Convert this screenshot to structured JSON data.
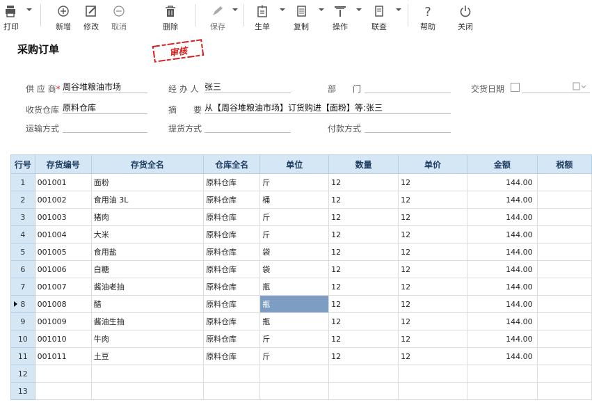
{
  "toolbar": {
    "buttons": [
      {
        "key": "print",
        "label": "打印",
        "icon": "printer-icon"
      },
      {
        "key": "new",
        "label": "新增",
        "icon": "plus-circle-icon"
      },
      {
        "key": "edit",
        "label": "修改",
        "icon": "edit-icon"
      },
      {
        "key": "cancel",
        "label": "取消",
        "icon": "minus-circle-icon"
      },
      {
        "key": "delete",
        "label": "删除",
        "icon": "trash-icon"
      },
      {
        "key": "save",
        "label": "保存",
        "icon": "pen-icon"
      },
      {
        "key": "generate",
        "label": "生单",
        "icon": "document-icon"
      },
      {
        "key": "copy",
        "label": "复制",
        "icon": "copy-icon"
      },
      {
        "key": "operate",
        "label": "操作",
        "icon": "operate-icon"
      },
      {
        "key": "query",
        "label": "联查",
        "icon": "link-query-icon"
      },
      {
        "key": "help",
        "label": "帮助",
        "icon": "help-icon"
      },
      {
        "key": "close",
        "label": "关闭",
        "icon": "power-icon"
      }
    ]
  },
  "page": {
    "title": "采购订单",
    "stamp": "审核"
  },
  "form": {
    "supplier_label": "供 应 商",
    "supplier_req": "*",
    "supplier_value": "周谷堆粮油市场",
    "handler_label": "经 办 人",
    "handler_value": "张三",
    "dept_label": "部　　门",
    "dept_value": "",
    "delivery_date_label": "交货日期",
    "warehouse_label": "收货仓库",
    "warehouse_value": "原料仓库",
    "summary_label": "摘　　要",
    "summary_value": "从【周谷堆粮油市场】订货购进【面粉】等:张三",
    "transport_label": "运输方式",
    "transport_value": "",
    "pickup_label": "提货方式",
    "pickup_value": "",
    "payment_label": "付款方式",
    "payment_value": ""
  },
  "table": {
    "columns": [
      "行号",
      "存货编号",
      "存货全名",
      "仓库全名",
      "单位",
      "数量",
      "单价",
      "金额",
      "税额"
    ],
    "rows": [
      {
        "no": "1",
        "code": "001001",
        "name": "面粉",
        "wh": "原料仓库",
        "unit": "斤",
        "qty": "12",
        "price": "12",
        "amount": "144.00"
      },
      {
        "no": "2",
        "code": "001002",
        "name": "食用油 3L",
        "wh": "原料仓库",
        "unit": "桶",
        "qty": "12",
        "price": "12",
        "amount": "144.00"
      },
      {
        "no": "3",
        "code": "001003",
        "name": "猪肉",
        "wh": "原料仓库",
        "unit": "斤",
        "qty": "12",
        "price": "12",
        "amount": "144.00"
      },
      {
        "no": "4",
        "code": "001004",
        "name": "大米",
        "wh": "原料仓库",
        "unit": "斤",
        "qty": "12",
        "price": "12",
        "amount": "144.00"
      },
      {
        "no": "5",
        "code": "001005",
        "name": "食用盐",
        "wh": "原料仓库",
        "unit": "袋",
        "qty": "12",
        "price": "12",
        "amount": "144.00"
      },
      {
        "no": "6",
        "code": "001006",
        "name": "白糖",
        "wh": "原料仓库",
        "unit": "袋",
        "qty": "12",
        "price": "12",
        "amount": "144.00"
      },
      {
        "no": "7",
        "code": "001007",
        "name": "酱油老抽",
        "wh": "原料仓库",
        "unit": "瓶",
        "qty": "12",
        "price": "12",
        "amount": "144.00"
      },
      {
        "no": "8",
        "code": "001008",
        "name": "醋",
        "wh": "原料仓库",
        "unit": "瓶",
        "qty": "12",
        "price": "12",
        "amount": "144.00"
      },
      {
        "no": "9",
        "code": "001009",
        "name": "酱油生抽",
        "wh": "原料仓库",
        "unit": "瓶",
        "qty": "12",
        "price": "12",
        "amount": "144.00"
      },
      {
        "no": "10",
        "code": "001010",
        "name": "牛肉",
        "wh": "原料仓库",
        "unit": "斤",
        "qty": "12",
        "price": "12",
        "amount": "144.00"
      },
      {
        "no": "11",
        "code": "001011",
        "name": "土豆",
        "wh": "原料仓库",
        "unit": "斤",
        "qty": "12",
        "price": "12",
        "amount": "144.00"
      },
      {
        "no": "12",
        "code": "",
        "name": "",
        "wh": "",
        "unit": "",
        "qty": "",
        "price": "",
        "amount": ""
      },
      {
        "no": "13",
        "code": "",
        "name": "",
        "wh": "",
        "unit": "",
        "qty": "",
        "price": "",
        "amount": ""
      }
    ],
    "selected_row": 7
  }
}
